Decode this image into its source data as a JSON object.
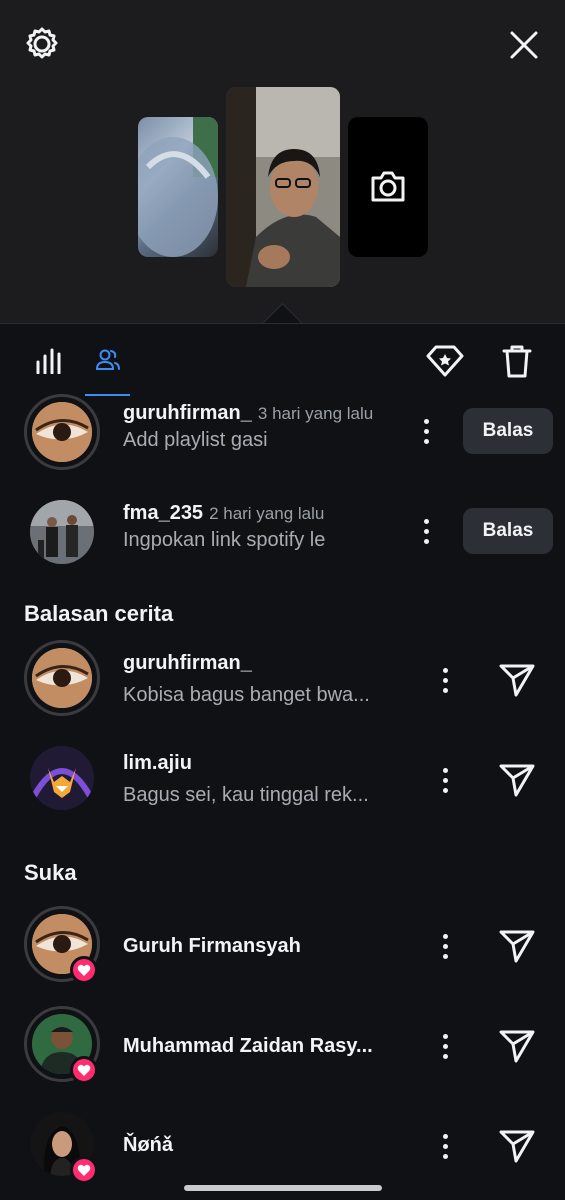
{
  "toolbar": {
    "tabs": [
      {
        "icon": "bar-chart-icon",
        "active": false
      },
      {
        "icon": "people-icon",
        "active": true
      }
    ],
    "actions": [
      "highlight-icon",
      "trash-icon"
    ]
  },
  "activity": [
    {
      "username": "guruhfirman_",
      "time": "3 hari yang lalu",
      "message": "Add playlist gasi",
      "button": "Balas"
    },
    {
      "username": "fma_235",
      "time": "2 hari yang lalu",
      "message": "Ingpokan link spotify le",
      "button": "Balas"
    }
  ],
  "replies_section": {
    "title": "Balasan cerita",
    "items": [
      {
        "username": "guruhfirman_",
        "message": "Kobisa bagus banget bwa..."
      },
      {
        "username": "lim.ajiu",
        "message": "Bagus sei, kau tinggal rek..."
      }
    ]
  },
  "likes_section": {
    "title": "Suka",
    "items": [
      {
        "name": "Guruh Firmansyah"
      },
      {
        "name": "Muhammad Zaidan Rasy..."
      },
      {
        "name": "Ňøńǎ"
      }
    ]
  },
  "colors": {
    "accent": "#3b8df6",
    "like": "#ff2d6f",
    "background": "#0f1115"
  }
}
